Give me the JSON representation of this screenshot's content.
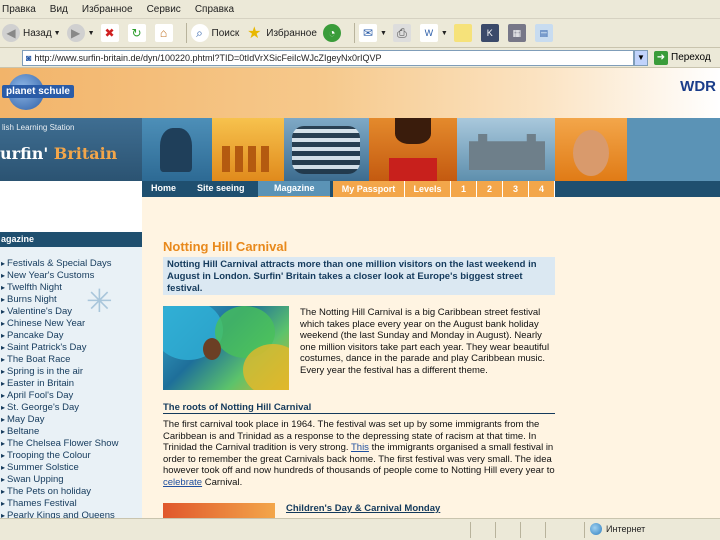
{
  "browser": {
    "menu": [
      "Правка",
      "Вид",
      "Избранное",
      "Сервис",
      "Справка"
    ],
    "toolbar": {
      "back_label": "Назад",
      "search_label": "Поиск",
      "favorites_label": "Избранное"
    },
    "address": {
      "url": "http://www.surfin-britain.de/dyn/100220.phtml?TID=0tIdVrXSicFeiIcWJcZIgeyNx0rIQVP",
      "go_label": "Переход"
    },
    "status": {
      "zone_label": "Интернет"
    }
  },
  "site": {
    "logo_text": "planet schule",
    "brand": "WDR",
    "station": "lish Learning Station",
    "title_part1": "urfin' ",
    "title_part2": "Britain",
    "nav": [
      {
        "label": "Home"
      },
      {
        "label": "Site seeing"
      },
      {
        "label": "Magazine"
      },
      {
        "label": "My Passport"
      },
      {
        "label": "Levels"
      },
      {
        "label": "1"
      },
      {
        "label": "2"
      },
      {
        "label": "3"
      },
      {
        "label": "4"
      }
    ]
  },
  "sidebar": {
    "title": "agazine",
    "items": [
      "Festivals & Special Days",
      "New Year's Customs",
      "Twelfth Night",
      "Burns Night",
      "Valentine's Day",
      "Chinese New Year",
      "Pancake Day",
      "Saint Patrick's Day",
      "The Boat Race",
      "Spring is in the air",
      "Easter in Britain",
      "April Fool's Day",
      "St. George's Day",
      "May Day",
      "Beltane",
      "The Chelsea Flower Show",
      "Trooping the Colour",
      "Summer Solstice",
      "Swan Upping",
      "The Pets on holiday",
      "Thames Festival",
      "Pearly Kings and Queens"
    ]
  },
  "content": {
    "title": "Notting Hill Carnival",
    "intro": "Notting Hill Carnival attracts more than one million visitors on the last weekend in August in London. Surfin' Britain takes a closer look at Europe's biggest street festival.",
    "para1": "The Notting Hill Carnival is a big Caribbean street festival which takes place every year on the August bank holiday weekend (the last Sunday and Monday in August). Nearly one million visitors take part each year. They wear beautiful costumes, dance in the parade and play Caribbean music. Every year the festival has a different theme.",
    "section1_heading": "The roots of Notting Hill Carnival",
    "para2_before": "The first carnival took place in 1964. The festival was set up by some immigrants from the Caribbean is and Trinidad as a response to the depressing state of racism at that time. In Trinidad the Carnival tradition is very strong. ",
    "para2_link1": "This",
    "para2_middle": " the immigrants organised a small festival in order to remember the great Carnivals back home. The first festival was very small. The idea however took off and now hundreds of thousands of people come to Notting Hill every year to ",
    "para2_link2": "celebrate",
    "para2_after": " Carnival.",
    "section2_heading": "Children's Day & Carnival Monday"
  }
}
